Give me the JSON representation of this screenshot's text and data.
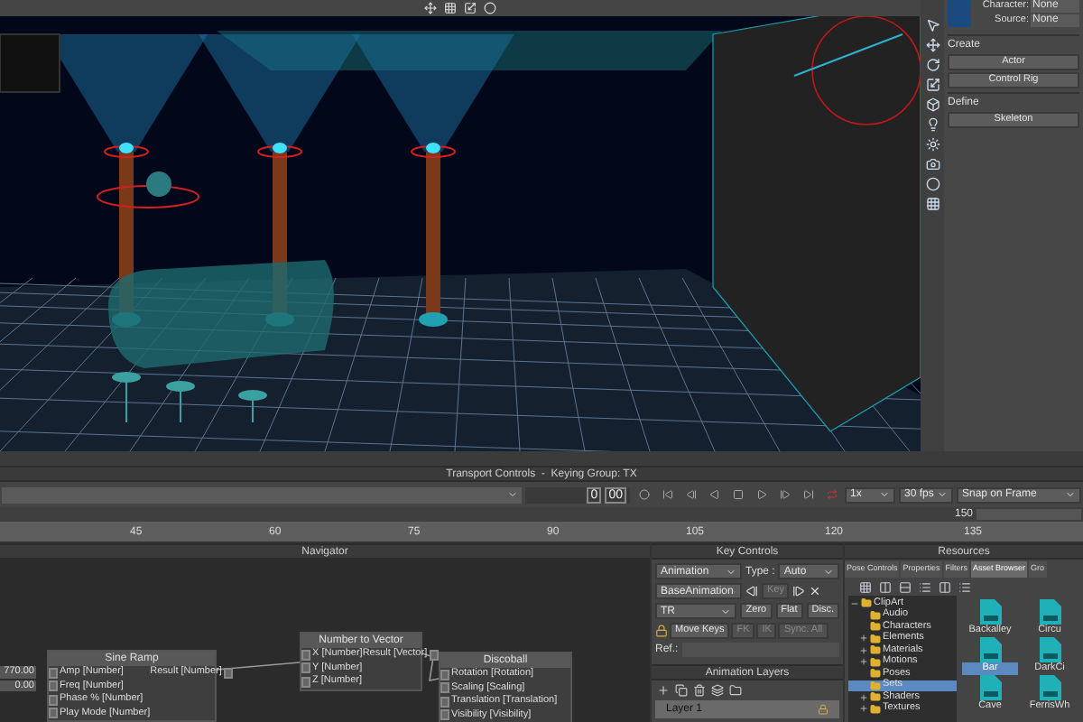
{
  "character_panel": {
    "fields": [
      {
        "label": "Character:",
        "value": "None"
      },
      {
        "label": "Source:",
        "value": "None"
      }
    ],
    "sections": [
      {
        "title": "Create",
        "buttons": [
          "Actor",
          "Control Rig"
        ]
      },
      {
        "title": "Define",
        "buttons": [
          "Skeleton"
        ]
      }
    ]
  },
  "transport": {
    "title": "Transport Controls  -  Keying Group: TX",
    "timecode": [
      "0",
      "00"
    ],
    "speed": "1x",
    "fps": "30 fps",
    "snap": "Snap on Frame",
    "end_frame": "150",
    "ruler_ticks": [
      "45",
      "60",
      "75",
      "90",
      "105",
      "120",
      "135"
    ]
  },
  "navigator": {
    "title": "Navigator",
    "nodes": [
      {
        "title": "Sine Ramp",
        "inputs": [
          {
            "label": "Amp [Number]",
            "value": "770.00"
          },
          {
            "label": "Freq [Number]",
            "value": "0.00"
          },
          {
            "label": "Phase % [Number]"
          },
          {
            "label": "Play Mode [Number]"
          }
        ],
        "outputs": [
          "Result [Number]"
        ]
      },
      {
        "title": "Number to Vector",
        "inputs": [
          {
            "label": "X [Number]"
          },
          {
            "label": "Y [Number]"
          },
          {
            "label": "Z [Number]"
          }
        ],
        "outputs": [
          "Result [Vector]"
        ]
      },
      {
        "title": "Discoball",
        "inputs": [
          {
            "label": "Rotation [Rotation]"
          },
          {
            "label": "Scaling [Scaling]"
          },
          {
            "label": "Translation [Translation]"
          },
          {
            "label": "Visibility [Visibility]"
          }
        ]
      }
    ]
  },
  "key_controls": {
    "title": "Key Controls",
    "mode": "Animation",
    "type_label": "Type :",
    "type": "Auto",
    "layer": "BaseAnimation",
    "key_button": {
      "label": "Key",
      "disabled": true
    },
    "group": "TR",
    "buttons": [
      {
        "label": "Zero",
        "disabled": false
      },
      {
        "label": "Flat",
        "disabled": false
      },
      {
        "label": "Disc.",
        "disabled": false
      }
    ],
    "move_keys": "Move Keys",
    "ik_buttons": [
      {
        "label": "FK",
        "disabled": true
      },
      {
        "label": "IK",
        "disabled": true
      },
      {
        "label": "Sync. All",
        "disabled": true
      }
    ],
    "ref_label": "Ref.:",
    "layers_title": "Animation Layers",
    "layers": [
      {
        "name": "Layer 1",
        "selected": false
      }
    ]
  },
  "resources": {
    "title": "Resources",
    "tabs": [
      {
        "label": "Pose Controls",
        "selected": false
      },
      {
        "label": "Properties",
        "selected": false
      },
      {
        "label": "Filters",
        "selected": false
      },
      {
        "label": "Asset Browser",
        "selected": true
      },
      {
        "label": "Gro",
        "selected": false
      }
    ],
    "tree": [
      {
        "label": "ClipArt",
        "expanded": true,
        "selected": false,
        "children": [
          {
            "label": "Audio",
            "expandable": false,
            "selected": false
          },
          {
            "label": "Characters",
            "expandable": false,
            "selected": false
          },
          {
            "label": "Elements",
            "expandable": true,
            "selected": false
          },
          {
            "label": "Materials",
            "expandable": true,
            "selected": false
          },
          {
            "label": "Motions",
            "expandable": true,
            "selected": false
          },
          {
            "label": "Poses",
            "expandable": false,
            "selected": false
          },
          {
            "label": "Sets",
            "expandable": false,
            "selected": true
          },
          {
            "label": "Shaders",
            "expandable": true,
            "selected": false
          },
          {
            "label": "Textures",
            "expandable": true,
            "selected": false
          }
        ]
      }
    ],
    "assets": [
      {
        "label": "Backalley",
        "selected": false
      },
      {
        "label": "Circu",
        "selected": false
      },
      {
        "label": "Bar",
        "selected": true
      },
      {
        "label": "DarkCi",
        "selected": false
      },
      {
        "label": "Cave",
        "selected": false
      },
      {
        "label": "FerrisWh",
        "selected": false
      }
    ]
  }
}
